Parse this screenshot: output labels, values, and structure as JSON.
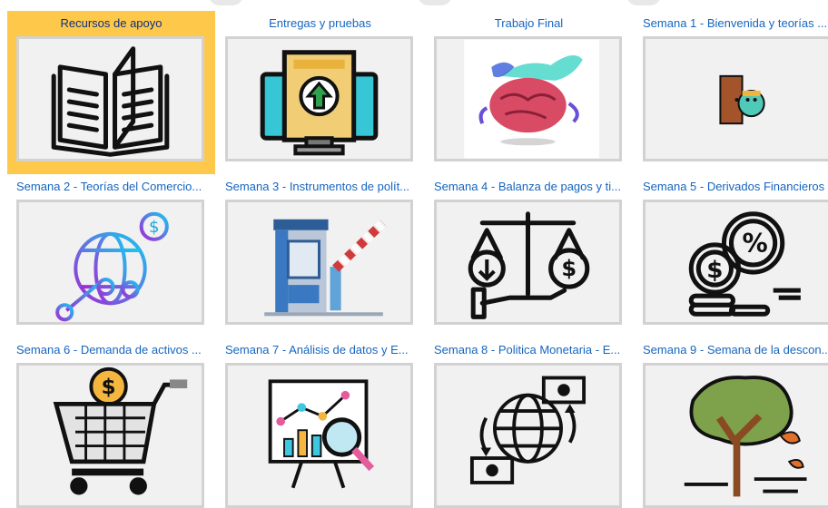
{
  "tiles": [
    {
      "title": "Recursos de apoyo",
      "image": "open-book-icon",
      "active": true
    },
    {
      "title": "Entregas y pruebas",
      "image": "upload-computer-icon"
    },
    {
      "title": "Trabajo Final",
      "image": "brain-map-icon"
    },
    {
      "title": "Semana 1 - Bienvenida y teorías ...",
      "image": "door-welcome-icon"
    },
    {
      "title": "Semana 2 - Teorías del Comercio...",
      "image": "global-network-dollar-icon"
    },
    {
      "title": "Semana 3 - Instrumentos de polít...",
      "image": "toll-booth-barrier-icon"
    },
    {
      "title": "Semana 4 - Balanza de pagos y ti...",
      "image": "balance-scale-dollar-icon"
    },
    {
      "title": "Semana 5 - Derivados Financieros",
      "image": "coins-percent-icon"
    },
    {
      "title": "Semana 6 - Demanda de activos ...",
      "image": "shopping-cart-dollar-icon"
    },
    {
      "title": "Semana 7 - Análisis de datos y E...",
      "image": "data-analysis-board-icon"
    },
    {
      "title": "Semana 8 - Politica Monetaria - E...",
      "image": "globe-money-exchange-icon"
    },
    {
      "title": "Semana 9 - Semana de la descon...",
      "image": "tree-wind-icon"
    }
  ],
  "colors": {
    "active_tile": "#fec84a",
    "title_link": "#1565c0",
    "active_title": "#0d2f82",
    "image_border": "#d2d2d2"
  }
}
